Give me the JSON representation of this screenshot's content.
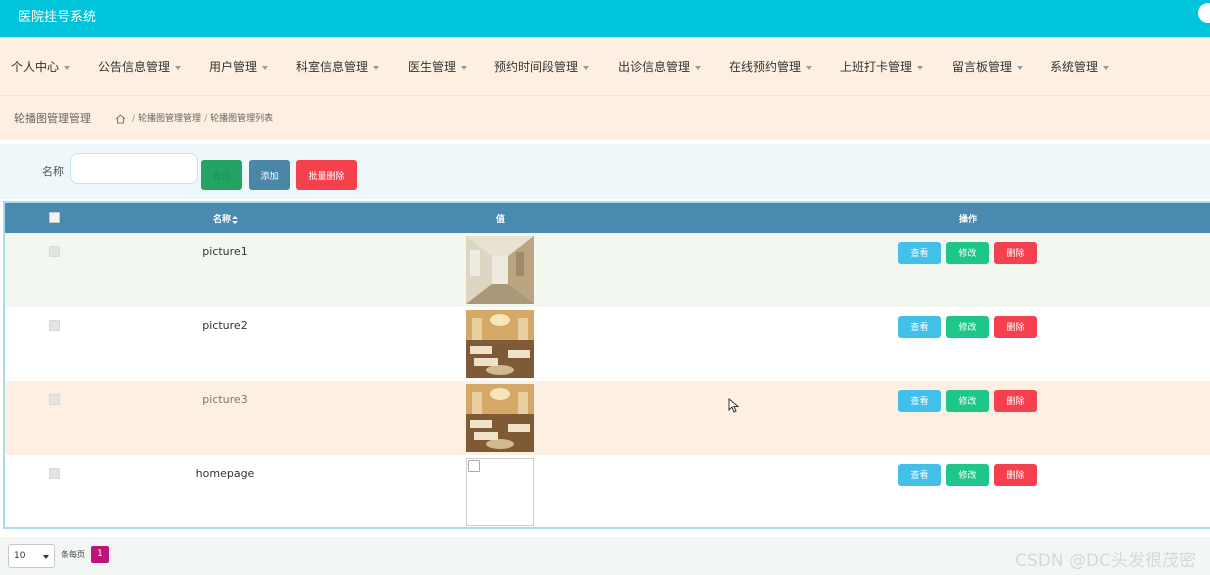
{
  "header": {
    "app_title": "医院挂号系统"
  },
  "nav": {
    "items": [
      {
        "label": "个人中心"
      },
      {
        "label": "公告信息管理"
      },
      {
        "label": "用户管理"
      },
      {
        "label": "科室信息管理"
      },
      {
        "label": "医生管理"
      },
      {
        "label": "预约时间段管理"
      },
      {
        "label": "出诊信息管理"
      },
      {
        "label": "在线预约管理"
      },
      {
        "label": "上班打卡管理"
      },
      {
        "label": "留言板管理"
      },
      {
        "label": "系统管理"
      }
    ]
  },
  "breadcrumb": {
    "page_title": "轮播图管理管理",
    "sep": "/",
    "items": [
      "轮播图管理管理",
      "轮播图管理列表"
    ]
  },
  "search": {
    "label": "名称",
    "input_value": "",
    "input_placeholder": "",
    "query_label": "查询",
    "add_label": "添加",
    "batch_delete_label": "批量删除"
  },
  "table": {
    "headers": {
      "name": "名称",
      "value": "值",
      "actions": "操作"
    },
    "rows": [
      {
        "name": "picture1",
        "image": "corridor",
        "bg": "#f2f7f0"
      },
      {
        "name": "picture2",
        "image": "ward",
        "bg": "#ffffff"
      },
      {
        "name": "picture3",
        "image": "ward",
        "bg": "#fdf0e2"
      },
      {
        "name": "homepage",
        "image": "broken",
        "bg": "#ffffff"
      }
    ],
    "actions": {
      "view": "查看",
      "edit": "修改",
      "delete": "删除"
    }
  },
  "pager": {
    "page_size": "10",
    "per_page_label": "条每页",
    "current_page": "1"
  },
  "watermark": "CSDN @DC头发很茂密",
  "colors": {
    "topbar": "#00c3dc",
    "nav_bg": "#fdf0e2",
    "table_header": "#4a8ab0",
    "view_btn": "#42c0ea",
    "edit_btn": "#1ec68a",
    "delete_btn": "#f5414e",
    "page_active": "#c0137b"
  }
}
